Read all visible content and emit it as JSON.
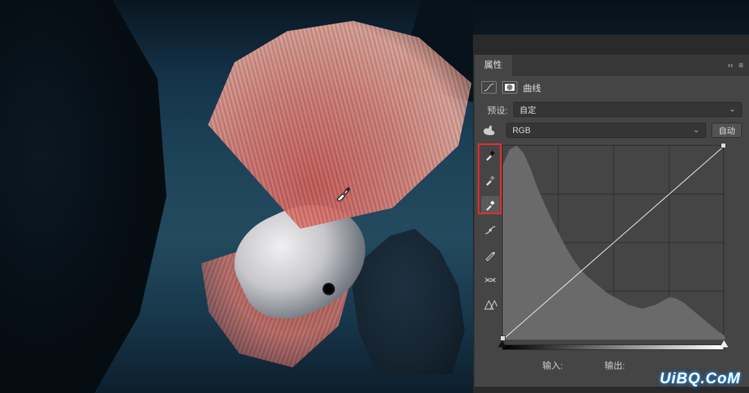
{
  "panel": {
    "title": "属性",
    "adjustment_type": "曲线",
    "preset_label": "预设:",
    "preset_value": "自定",
    "channel_value": "RGB",
    "auto_button": "自动",
    "input_label": "输入:",
    "output_label": "输出:"
  },
  "tools": [
    {
      "name": "eyedropper-black"
    },
    {
      "name": "eyedropper-gray"
    },
    {
      "name": "eyedropper-white"
    },
    {
      "name": "curve-draw"
    },
    {
      "name": "pencil"
    },
    {
      "name": "curve-smooth"
    },
    {
      "name": "clip-warning"
    }
  ],
  "chart_data": {
    "type": "line",
    "title": "曲线",
    "xlabel": "输入",
    "ylabel": "输出",
    "xlim": [
      0,
      255
    ],
    "ylim": [
      0,
      255
    ],
    "grid": true,
    "series": [
      {
        "name": "RGB curve",
        "x": [
          0,
          255
        ],
        "y": [
          0,
          255
        ]
      }
    ],
    "control_points": [
      {
        "x": 0,
        "y": 0
      },
      {
        "x": 255,
        "y": 255
      }
    ],
    "histogram": {
      "bins_x": [
        0,
        8,
        16,
        24,
        32,
        40,
        48,
        56,
        64,
        72,
        80,
        88,
        96,
        104,
        112,
        120,
        128,
        136,
        144,
        152,
        160,
        168,
        176,
        184,
        192,
        200,
        208,
        216,
        224,
        232,
        240,
        248,
        255
      ],
      "heights_pct": [
        90,
        98,
        100,
        96,
        88,
        78,
        70,
        62,
        55,
        48,
        42,
        37,
        33,
        30,
        27,
        24,
        22,
        20,
        18,
        17,
        16,
        17,
        18,
        20,
        22,
        21,
        19,
        16,
        13,
        10,
        7,
        4,
        2
      ]
    },
    "slider": {
      "black": 0,
      "white": 255
    }
  },
  "watermark": "UiBQ.CoM"
}
